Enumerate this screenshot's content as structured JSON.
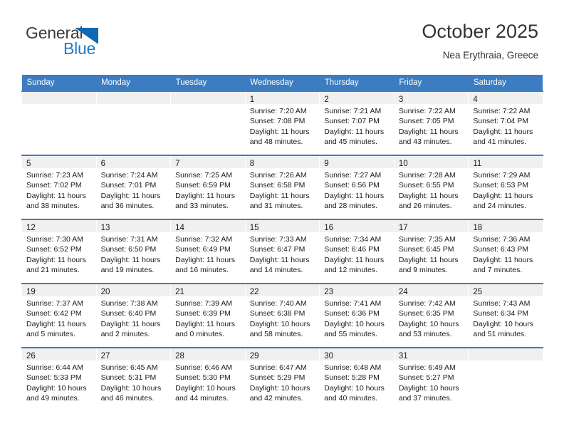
{
  "brand": {
    "name_part1": "General",
    "name_part2": "Blue",
    "accent_color": "#1f7ac4",
    "triangle_icon": "triangle-icon"
  },
  "header": {
    "title": "October 2025",
    "subtitle": "Nea Erythraia, Greece",
    "header_bg_color": "#3b7dc0"
  },
  "weekdays": [
    "Sunday",
    "Monday",
    "Tuesday",
    "Wednesday",
    "Thursday",
    "Friday",
    "Saturday"
  ],
  "weeks": [
    [
      {
        "day": "",
        "empty": true
      },
      {
        "day": "",
        "empty": true
      },
      {
        "day": "",
        "empty": true
      },
      {
        "day": "1",
        "sunrise": "Sunrise: 7:20 AM",
        "sunset": "Sunset: 7:08 PM",
        "daylight1": "Daylight: 11 hours",
        "daylight2": "and 48 minutes."
      },
      {
        "day": "2",
        "sunrise": "Sunrise: 7:21 AM",
        "sunset": "Sunset: 7:07 PM",
        "daylight1": "Daylight: 11 hours",
        "daylight2": "and 45 minutes."
      },
      {
        "day": "3",
        "sunrise": "Sunrise: 7:22 AM",
        "sunset": "Sunset: 7:05 PM",
        "daylight1": "Daylight: 11 hours",
        "daylight2": "and 43 minutes."
      },
      {
        "day": "4",
        "sunrise": "Sunrise: 7:22 AM",
        "sunset": "Sunset: 7:04 PM",
        "daylight1": "Daylight: 11 hours",
        "daylight2": "and 41 minutes."
      }
    ],
    [
      {
        "day": "5",
        "sunrise": "Sunrise: 7:23 AM",
        "sunset": "Sunset: 7:02 PM",
        "daylight1": "Daylight: 11 hours",
        "daylight2": "and 38 minutes."
      },
      {
        "day": "6",
        "sunrise": "Sunrise: 7:24 AM",
        "sunset": "Sunset: 7:01 PM",
        "daylight1": "Daylight: 11 hours",
        "daylight2": "and 36 minutes."
      },
      {
        "day": "7",
        "sunrise": "Sunrise: 7:25 AM",
        "sunset": "Sunset: 6:59 PM",
        "daylight1": "Daylight: 11 hours",
        "daylight2": "and 33 minutes."
      },
      {
        "day": "8",
        "sunrise": "Sunrise: 7:26 AM",
        "sunset": "Sunset: 6:58 PM",
        "daylight1": "Daylight: 11 hours",
        "daylight2": "and 31 minutes."
      },
      {
        "day": "9",
        "sunrise": "Sunrise: 7:27 AM",
        "sunset": "Sunset: 6:56 PM",
        "daylight1": "Daylight: 11 hours",
        "daylight2": "and 28 minutes."
      },
      {
        "day": "10",
        "sunrise": "Sunrise: 7:28 AM",
        "sunset": "Sunset: 6:55 PM",
        "daylight1": "Daylight: 11 hours",
        "daylight2": "and 26 minutes."
      },
      {
        "day": "11",
        "sunrise": "Sunrise: 7:29 AM",
        "sunset": "Sunset: 6:53 PM",
        "daylight1": "Daylight: 11 hours",
        "daylight2": "and 24 minutes."
      }
    ],
    [
      {
        "day": "12",
        "sunrise": "Sunrise: 7:30 AM",
        "sunset": "Sunset: 6:52 PM",
        "daylight1": "Daylight: 11 hours",
        "daylight2": "and 21 minutes."
      },
      {
        "day": "13",
        "sunrise": "Sunrise: 7:31 AM",
        "sunset": "Sunset: 6:50 PM",
        "daylight1": "Daylight: 11 hours",
        "daylight2": "and 19 minutes."
      },
      {
        "day": "14",
        "sunrise": "Sunrise: 7:32 AM",
        "sunset": "Sunset: 6:49 PM",
        "daylight1": "Daylight: 11 hours",
        "daylight2": "and 16 minutes."
      },
      {
        "day": "15",
        "sunrise": "Sunrise: 7:33 AM",
        "sunset": "Sunset: 6:47 PM",
        "daylight1": "Daylight: 11 hours",
        "daylight2": "and 14 minutes."
      },
      {
        "day": "16",
        "sunrise": "Sunrise: 7:34 AM",
        "sunset": "Sunset: 6:46 PM",
        "daylight1": "Daylight: 11 hours",
        "daylight2": "and 12 minutes."
      },
      {
        "day": "17",
        "sunrise": "Sunrise: 7:35 AM",
        "sunset": "Sunset: 6:45 PM",
        "daylight1": "Daylight: 11 hours",
        "daylight2": "and 9 minutes."
      },
      {
        "day": "18",
        "sunrise": "Sunrise: 7:36 AM",
        "sunset": "Sunset: 6:43 PM",
        "daylight1": "Daylight: 11 hours",
        "daylight2": "and 7 minutes."
      }
    ],
    [
      {
        "day": "19",
        "sunrise": "Sunrise: 7:37 AM",
        "sunset": "Sunset: 6:42 PM",
        "daylight1": "Daylight: 11 hours",
        "daylight2": "and 5 minutes."
      },
      {
        "day": "20",
        "sunrise": "Sunrise: 7:38 AM",
        "sunset": "Sunset: 6:40 PM",
        "daylight1": "Daylight: 11 hours",
        "daylight2": "and 2 minutes."
      },
      {
        "day": "21",
        "sunrise": "Sunrise: 7:39 AM",
        "sunset": "Sunset: 6:39 PM",
        "daylight1": "Daylight: 11 hours",
        "daylight2": "and 0 minutes."
      },
      {
        "day": "22",
        "sunrise": "Sunrise: 7:40 AM",
        "sunset": "Sunset: 6:38 PM",
        "daylight1": "Daylight: 10 hours",
        "daylight2": "and 58 minutes."
      },
      {
        "day": "23",
        "sunrise": "Sunrise: 7:41 AM",
        "sunset": "Sunset: 6:36 PM",
        "daylight1": "Daylight: 10 hours",
        "daylight2": "and 55 minutes."
      },
      {
        "day": "24",
        "sunrise": "Sunrise: 7:42 AM",
        "sunset": "Sunset: 6:35 PM",
        "daylight1": "Daylight: 10 hours",
        "daylight2": "and 53 minutes."
      },
      {
        "day": "25",
        "sunrise": "Sunrise: 7:43 AM",
        "sunset": "Sunset: 6:34 PM",
        "daylight1": "Daylight: 10 hours",
        "daylight2": "and 51 minutes."
      }
    ],
    [
      {
        "day": "26",
        "sunrise": "Sunrise: 6:44 AM",
        "sunset": "Sunset: 5:33 PM",
        "daylight1": "Daylight: 10 hours",
        "daylight2": "and 49 minutes."
      },
      {
        "day": "27",
        "sunrise": "Sunrise: 6:45 AM",
        "sunset": "Sunset: 5:31 PM",
        "daylight1": "Daylight: 10 hours",
        "daylight2": "and 46 minutes."
      },
      {
        "day": "28",
        "sunrise": "Sunrise: 6:46 AM",
        "sunset": "Sunset: 5:30 PM",
        "daylight1": "Daylight: 10 hours",
        "daylight2": "and 44 minutes."
      },
      {
        "day": "29",
        "sunrise": "Sunrise: 6:47 AM",
        "sunset": "Sunset: 5:29 PM",
        "daylight1": "Daylight: 10 hours",
        "daylight2": "and 42 minutes."
      },
      {
        "day": "30",
        "sunrise": "Sunrise: 6:48 AM",
        "sunset": "Sunset: 5:28 PM",
        "daylight1": "Daylight: 10 hours",
        "daylight2": "and 40 minutes."
      },
      {
        "day": "31",
        "sunrise": "Sunrise: 6:49 AM",
        "sunset": "Sunset: 5:27 PM",
        "daylight1": "Daylight: 10 hours",
        "daylight2": "and 37 minutes."
      },
      {
        "day": "",
        "empty": true
      }
    ]
  ]
}
